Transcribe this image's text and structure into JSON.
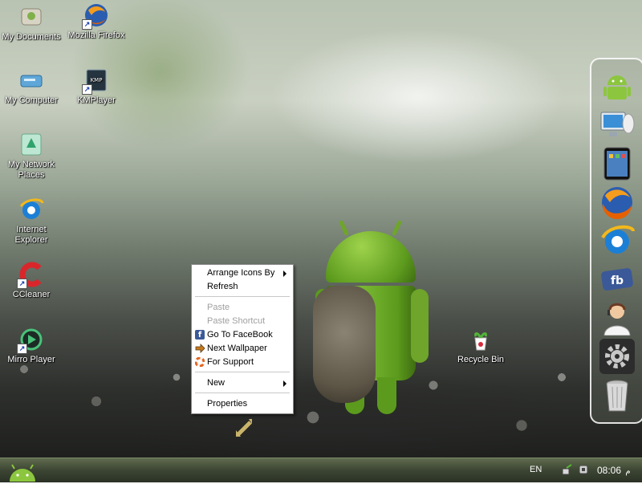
{
  "desktop_icons": [
    {
      "id": "my-documents",
      "label": "My Documents"
    },
    {
      "id": "mozilla-firefox",
      "label": "Mozilla Firefox"
    },
    {
      "id": "my-computer",
      "label": "My Computer"
    },
    {
      "id": "kmplayer",
      "label": "KMPlayer"
    },
    {
      "id": "my-network-places",
      "label_line1": "My Network",
      "label_line2": "Places"
    },
    {
      "id": "internet-explorer",
      "label_line1": "Internet",
      "label_line2": "Explorer"
    },
    {
      "id": "ccleaner",
      "label": "CCleaner"
    },
    {
      "id": "mirro-player",
      "label": "Mirro Player"
    },
    {
      "id": "recycle-bin",
      "label": "Recycle Bin"
    }
  ],
  "context_menu": {
    "items": [
      {
        "label": "Arrange Icons By",
        "submenu": true,
        "enabled": true
      },
      {
        "label": "Refresh",
        "enabled": true
      },
      {
        "label": "Paste",
        "enabled": false
      },
      {
        "label": "Paste Shortcut",
        "enabled": false
      },
      {
        "label": "Go To FaceBook",
        "enabled": true,
        "icon": "facebook-icon"
      },
      {
        "label": "Next Wallpaper",
        "enabled": true,
        "icon": "arrow-right-icon"
      },
      {
        "label": "For Support",
        "enabled": true,
        "icon": "lifebuoy-icon"
      },
      {
        "label": "New",
        "submenu": true,
        "enabled": true
      },
      {
        "label": "Properties",
        "enabled": true
      }
    ]
  },
  "dock": {
    "icons": [
      "android-icon",
      "computer-network-icon",
      "tablet-icon",
      "firefox-icon",
      "internet-explorer-icon",
      "facebook-icon",
      "support-agent-icon",
      "settings-gear-icon",
      "trash-can-icon"
    ]
  },
  "taskbar": {
    "start_icon": "android-start-icon",
    "language": "EN",
    "clock": "08:06",
    "clock_suffix": "م"
  },
  "colors": {
    "android_green": "#78c257",
    "taskbar": "#3c4533",
    "menu_bg": "#ffffff"
  }
}
